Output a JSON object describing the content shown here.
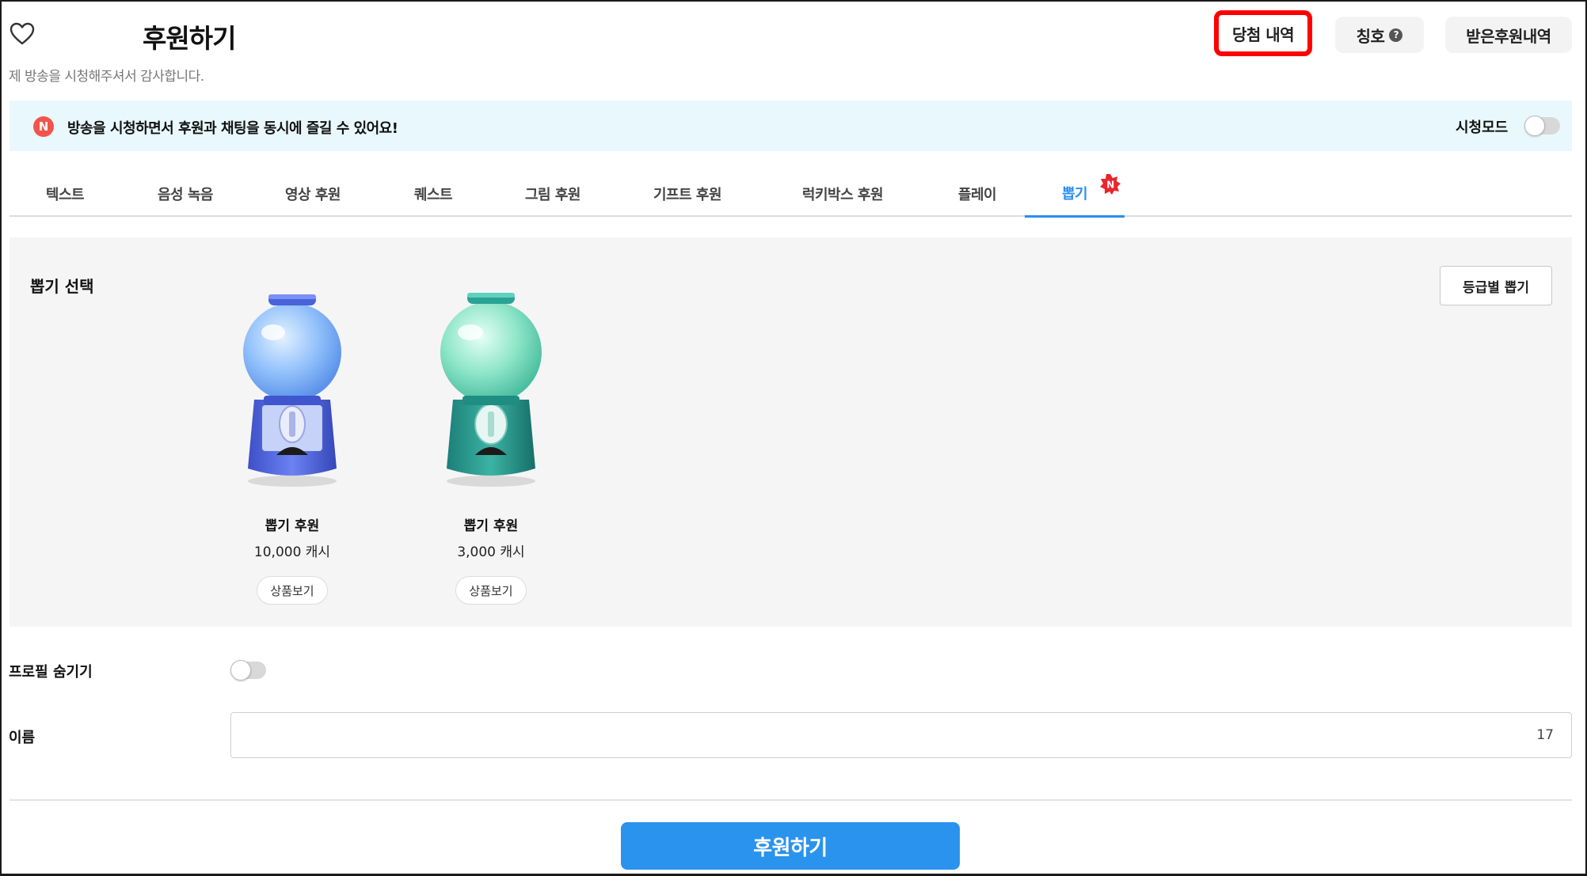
{
  "header": {
    "title": "후원하기",
    "subtitle": "제 방송을 시청해주셔서 감사합니다.",
    "buttons": {
      "winning_history": "당첨 내역",
      "title_label": "칭호",
      "received_donations": "받은후원내역"
    }
  },
  "notice": {
    "badge": "N",
    "text": "방송을 시청하면서 후원과 채팅을 동시에 즐길 수 있어요!",
    "watch_mode_label": "시청모드",
    "watch_mode_on": false
  },
  "tabs": [
    {
      "label": "텍스트"
    },
    {
      "label": "음성 녹음"
    },
    {
      "label": "영상 후원"
    },
    {
      "label": "퀘스트"
    },
    {
      "label": "그림 후원"
    },
    {
      "label": "기프트 후원"
    },
    {
      "label": "럭키박스 후원"
    },
    {
      "label": "플레이"
    },
    {
      "label": "뽑기",
      "active": true,
      "badge": "N"
    }
  ],
  "gacha": {
    "section_title": "뽑기 선택",
    "grade_button": "등급별 뽑기",
    "items": [
      {
        "name": "뽑기 후원",
        "price": "10,000 캐시",
        "button": "상품보기",
        "color": "blue"
      },
      {
        "name": "뽑기 후원",
        "price": "3,000 캐시",
        "button": "상품보기",
        "color": "teal"
      }
    ]
  },
  "form": {
    "hide_profile_label": "프로필 숨기기",
    "hide_profile_on": false,
    "name_label": "이름",
    "name_value": "",
    "name_counter": "17"
  },
  "submit_label": "후원하기",
  "colors": {
    "accent": "#2a93ee",
    "highlight": "#ff0000",
    "notice_bg": "#e9f8fc",
    "badge": "#f2544b"
  }
}
